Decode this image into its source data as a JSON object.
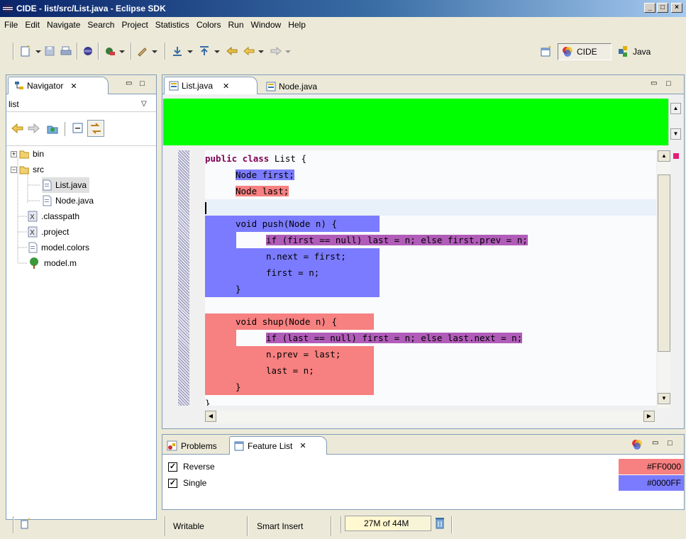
{
  "window": {
    "title": "CIDE - list/src/List.java - Eclipse SDK"
  },
  "menu": [
    "File",
    "Edit",
    "Navigate",
    "Search",
    "Project",
    "Statistics",
    "Colors",
    "Run",
    "Window",
    "Help"
  ],
  "perspectives": {
    "cide": "CIDE",
    "java": "Java"
  },
  "navigator": {
    "tab_label": "Navigator",
    "path": "list",
    "tree": [
      {
        "label": "bin",
        "icon": "folder-icon"
      },
      {
        "label": "src",
        "icon": "folder-icon"
      },
      {
        "label": "List.java",
        "icon": "java-file-icon"
      },
      {
        "label": "Node.java",
        "icon": "java-file-icon"
      },
      {
        "label": ".classpath",
        "icon": "xml-file-icon"
      },
      {
        "label": ".project",
        "icon": "xml-file-icon"
      },
      {
        "label": "model.colors",
        "icon": "text-file-icon"
      },
      {
        "label": "model.m",
        "icon": "tree-model-icon"
      }
    ]
  },
  "editor": {
    "tabs": [
      {
        "label": "List.java"
      },
      {
        "label": "Node.java"
      }
    ],
    "code": [
      {
        "kw": "public class",
        "text": " List {"
      },
      {
        "text": "Node first;"
      },
      {
        "text": "Node last;"
      },
      {
        "text": ""
      },
      {
        "text": "void push(Node n) {"
      },
      {
        "text": "if (first == null) last = n; else first.prev = n;"
      },
      {
        "text": "n.next = first;"
      },
      {
        "text": "first = n;"
      },
      {
        "text": "}"
      },
      {
        "text": ""
      },
      {
        "text": "void shup(Node n) {"
      },
      {
        "text": "if (last == null) first = n; else last.next = n;"
      },
      {
        "text": "n.prev = last;"
      },
      {
        "text": "last = n;"
      },
      {
        "text": "}"
      },
      {
        "text": "}"
      }
    ]
  },
  "bottom": {
    "tabs": [
      {
        "label": "Problems"
      },
      {
        "label": "Feature List"
      }
    ],
    "features": [
      {
        "name": "Reverse",
        "color": "#FF0000",
        "checked": true
      },
      {
        "name": "Single",
        "color": "#0000FF",
        "checked": true
      }
    ]
  },
  "status": {
    "writable": "Writable",
    "insert_mode": "Smart Insert",
    "memory": "27M of 44M"
  },
  "colors": {
    "green_banner": "#00ff00",
    "blue_feature": "#7b7bff",
    "red_feature": "#f78080",
    "overlap": "#b05cb8"
  }
}
